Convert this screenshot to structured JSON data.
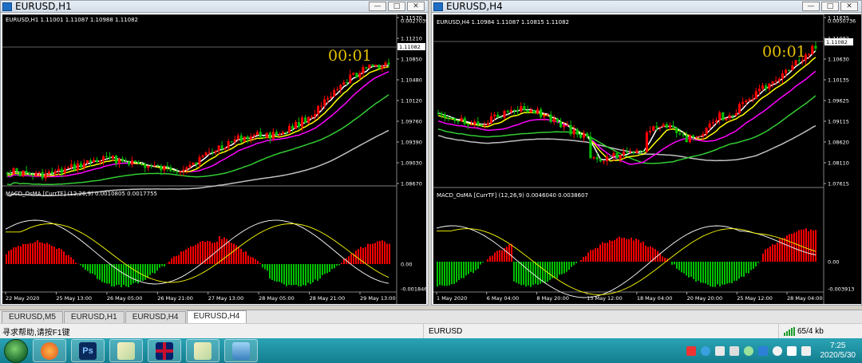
{
  "left_window": {
    "title": "EURUSD,H1",
    "info_line": "EURUSD,H1  1.11001 1.11087 1.10988 1.11082",
    "timer": "00:01",
    "current_price": "1.11082",
    "price_ticks": [
      "1.11570",
      "1.11210",
      "1.10850",
      "1.10480",
      "1.10120",
      "1.09760",
      "1.09390",
      "1.09030",
      "1.08670"
    ],
    "indicator_label": "MACD_OsMA [CurrTF] (12,26,9) 0.0010805 0.0017755",
    "indicator_ticks": [
      "0.0027039",
      "0.00",
      "-0.001846"
    ],
    "time_ticks": [
      "22 May 2020",
      "25 May 13:00",
      "26 May 05:00",
      "26 May 21:00",
      "27 May 13:00",
      "28 May 05:00",
      "28 May 21:00",
      "29 May 13:00"
    ]
  },
  "right_window": {
    "title": "EURUSD,H4",
    "info_line": "EURUSD,H4  1.10984 1.11087 1.10815 1.11082",
    "timer": "00:01",
    "current_price": "1.11082",
    "price_ticks": [
      "1.11635",
      "1.11082",
      "1.10630",
      "1.10135",
      "1.09625",
      "1.09115",
      "1.08620",
      "1.08110",
      "1.07615"
    ],
    "indicator_label": "MACD_OsMA [CurrTF] (12,26,9) 0.0046040 0.0038607",
    "indicator_ticks": [
      "0.0050736",
      "0.00",
      "-0.003913"
    ],
    "time_ticks": [
      "1 May 2020",
      "6 May 04:00",
      "8 May 20:00",
      "13 May 12:00",
      "18 May 04:00",
      "20 May 20:00",
      "25 May 12:00",
      "28 May 04:00"
    ]
  },
  "tabs": [
    "EURUSD,M5",
    "EURUSD,H1",
    "EURUSD,H4",
    "EURUSD,H4"
  ],
  "status": {
    "help": "寻求帮助,请按F1键",
    "symbol": "EURUSD",
    "traffic": "65/4 kb"
  },
  "clock": {
    "time": "7:25",
    "date": "2020/5/30"
  },
  "window_buttons": {
    "minimize": "—",
    "maximize": "□",
    "close": "✕"
  },
  "colors": {
    "chart_bg": "#000000",
    "bull_candle": "#ff0000",
    "bear_candle": "#00c000",
    "ma_fast": "#ffffff",
    "ma_mid": "#ffff00",
    "ma_slow": "#ff00ff",
    "ma_green": "#33cc33",
    "ma_grey": "#c0c0c0",
    "timer": "#e6c200"
  },
  "taskbar_icons": [
    "start-orb-icon",
    "browser-icon",
    "photoshop-icon",
    "metatrader-icon",
    "uk-flag-icon",
    "metatrader-icon-2",
    "image-viewer-icon"
  ]
}
